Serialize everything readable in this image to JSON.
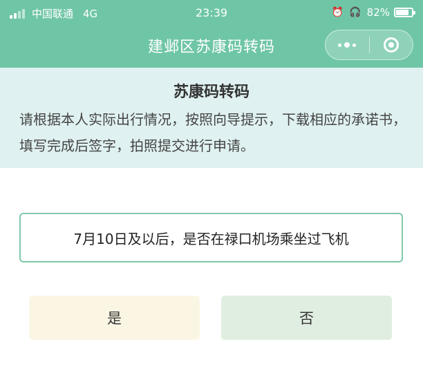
{
  "status_bar": {
    "carrier": "中国联通",
    "network": "4G",
    "time": "23:39",
    "battery": "82%",
    "battery_level": 0.82
  },
  "nav": {
    "title": "建邺区苏康码转码"
  },
  "notice": {
    "title": "苏康码转码",
    "description": "请根据本人实际出行情况，按照向导提示，下载相应的承诺书，填写完成后签字，拍照提交进行申请。"
  },
  "question": {
    "text": "7月10日及以后，是否在禄口机场乘坐过飞机"
  },
  "answers": {
    "yes": "是",
    "no": "否"
  },
  "colors": {
    "header_green": "#6fc6a7",
    "notice_bg": "#dff1f0",
    "question_border": "#7ec8a9",
    "yes_bg": "#fbf6e4",
    "no_bg": "#dfeee0"
  },
  "icons": [
    "signal-icon",
    "alarm-icon",
    "headphones-icon",
    "battery-icon",
    "more-dots-icon",
    "close-target-icon"
  ]
}
